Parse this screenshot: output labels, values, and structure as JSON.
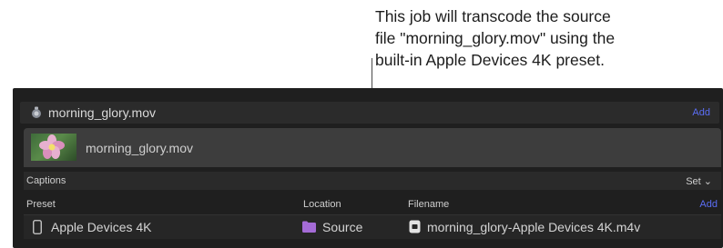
{
  "callout": {
    "lines": [
      "This job will transcode the source",
      "file \"morning_glory.mov\" using the",
      "built-in Apple Devices 4K preset."
    ]
  },
  "job": {
    "title": "morning_glory.mov",
    "add_label": "Add",
    "icon": "compressor-icon"
  },
  "source": {
    "name": "morning_glory.mov",
    "thumbnail": "flower-thumbnail"
  },
  "captions": {
    "label": "Captions",
    "set_label": "Set ⌄"
  },
  "table": {
    "columns": [
      "Preset",
      "Location",
      "Filename"
    ],
    "add_label": "Add",
    "rows": [
      {
        "preset": "Apple Devices 4K",
        "preset_icon": "iphone-icon",
        "location": "Source",
        "location_icon": "folder-icon",
        "location_color": "#a46bd6",
        "filename": "morning_glory-Apple Devices 4K.m4v",
        "filename_icon": "document-icon"
      }
    ]
  },
  "colors": {
    "accent": "#5b6ef5",
    "panel_bg": "#1f1f1f",
    "source_row_bg": "#3d3d3d"
  }
}
